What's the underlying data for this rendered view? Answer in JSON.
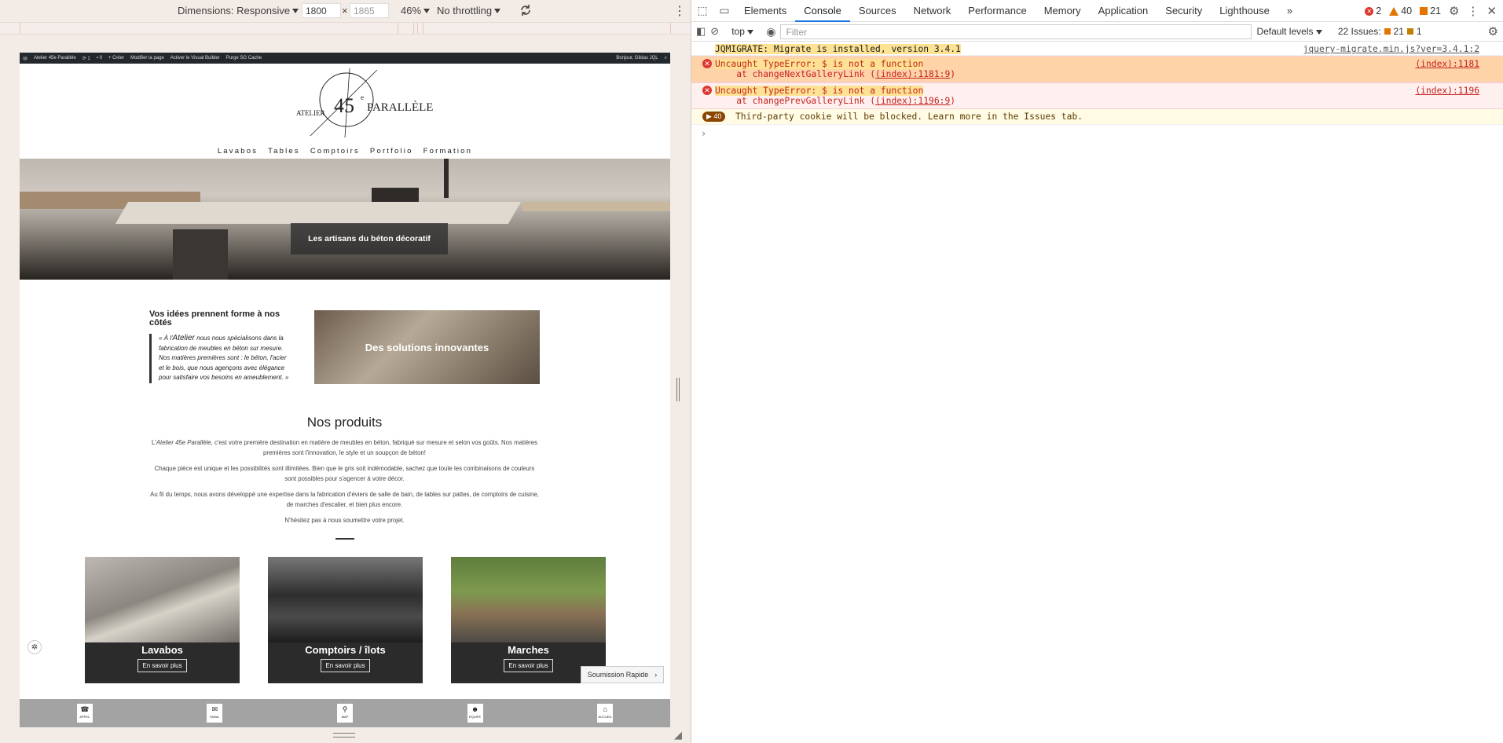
{
  "emu_toolbar": {
    "dimensions": "Dimensions: Responsive",
    "width": "1800",
    "x": "×",
    "height": "1865",
    "zoom": "46%",
    "throttle": "No throttling"
  },
  "wp_bar": {
    "site": "Atelier 45e Parallèle",
    "updates": "1",
    "comments": "0",
    "new": "+ Créer",
    "edit": "Modifier la page",
    "vb": "Activer le Visual Builder",
    "purge": "Purge SG Cache",
    "hello": "Bonjour, Gildas JQL"
  },
  "header": {
    "logo_atelier": "ATELIER",
    "logo_number": "45",
    "logo_sup": "e",
    "logo_name": "PARALLÈLE",
    "nav": [
      "Lavabos",
      "Tables",
      "Comptoirs",
      "Portfolio",
      "Formation"
    ]
  },
  "hero": {
    "caption": "Les artisans du béton décoratif"
  },
  "intro": {
    "title": "Vos idées prennent forme à nos côtés",
    "quote_a": "« À l'",
    "quote_brand": "Atelier",
    "quote_b": " nous nous spécialisons dans la fabrication de meubles en béton sur mesure.  Nos matières premières sont : le béton, l'acier et le bois, que nous agençons avec élégance pour satisfaire vos besoins en ameublement. »"
  },
  "solutions": {
    "label": "Des solutions innovantes"
  },
  "products": {
    "title": "Nos produits",
    "p1_a": "L'",
    "p1_brand": "Atelier 45e Parallèle",
    "p1_b": ", c'est votre première destination en matière de meubles en béton, fabriqué sur mesure et selon vos goûts. Nos matières premières sont l'innovation, le style et un soupçon de béton!",
    "p2": "Chaque pièce est unique et les possibilités sont illimitées. Bien que le gris soit indémodable, sachez que toute les combinaisons de couleurs sont possibles pour s'agencer à votre décor.",
    "p3": "Au fil du temps, nous avons développé une expertise dans la fabrication d'éviers de salle de bain, de tables sur pattes, de comptoirs de cuisine, de marches d'escalier, et bien plus encore.",
    "p4": "N'hésitez pas à nous soumettre votre projet."
  },
  "cards": [
    {
      "title": "Lavabos",
      "button": "En savoir plus"
    },
    {
      "title": "Comptoirs / îlots",
      "button": "En savoir plus"
    },
    {
      "title": "Marches",
      "button": "En savoir plus"
    }
  ],
  "soumission": {
    "label": "Soumission Rapide",
    "arrow": "›"
  },
  "footer": [
    {
      "icon": "☎",
      "label": "APPEL"
    },
    {
      "icon": "✉",
      "label": "EMAIL"
    },
    {
      "icon": "⚲",
      "label": "MAP"
    },
    {
      "icon": "☻",
      "label": "ÉQUIPE"
    },
    {
      "icon": "⌂",
      "label": "ACCUEIL"
    }
  ],
  "devtools": {
    "tabs": [
      "Elements",
      "Console",
      "Sources",
      "Network",
      "Performance",
      "Memory",
      "Application",
      "Security",
      "Lighthouse"
    ],
    "more": "»",
    "errors": "2",
    "warnings": "40",
    "info": "21",
    "context": "top",
    "filter_placeholder": "Filter",
    "levels": "Default levels",
    "issues_label": "22 Issues:",
    "issues_warn": "21",
    "issues_info": "1"
  },
  "console": {
    "l1_msg": "JQMIGRATE: Migrate is installed, version 3.4.1",
    "l1_src": "jquery-migrate.min.js?ver=3.4.1:2",
    "e1_msg": "Uncaught TypeError: $ is not a function",
    "e1_at": "    at changeNextGalleryLink (",
    "e1_link": "(index):1181:9",
    "e1_close": ")",
    "e1_src": "(index):1181",
    "e2_msg": "Uncaught TypeError: $ is not a function",
    "e2_at": "    at changePrevGalleryLink (",
    "e2_link": "(index):1196:9",
    "e2_close": ")",
    "e2_src": "(index):1196",
    "w_count": "40",
    "w_msg": "Third-party cookie will be blocked. Learn more in the Issues tab.",
    "prompt": "›"
  },
  "colors": {
    "accent": "#1a73e8",
    "error": "#dc362e",
    "warning": "#e37400"
  }
}
